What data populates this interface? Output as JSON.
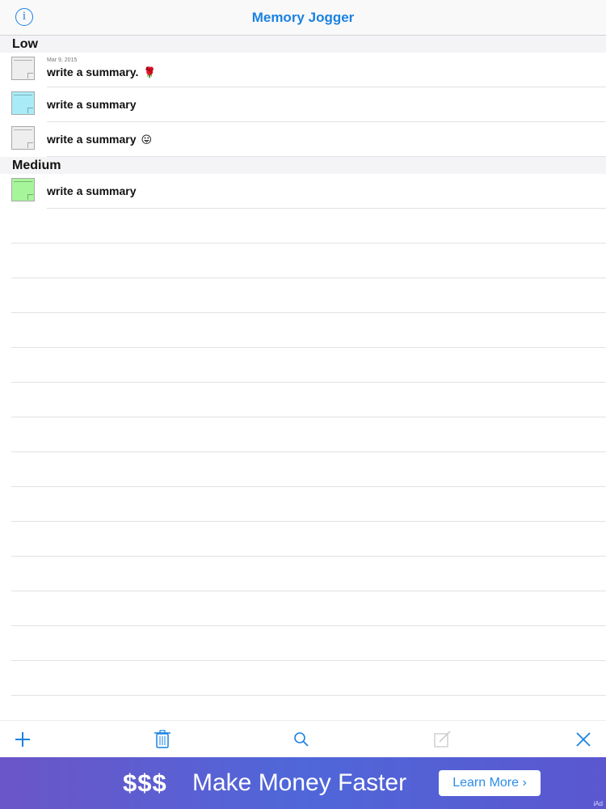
{
  "header": {
    "title": "Memory Jogger",
    "info_label": "i"
  },
  "sections": [
    {
      "title": "Low",
      "items": [
        {
          "date": "Mar 9, 2015",
          "text": "write a summary.",
          "emoji": "🌹",
          "note_color": "#eeeeee"
        },
        {
          "date": "",
          "text": "write a summary",
          "emoji": "",
          "note_color": "#a9ecf8"
        },
        {
          "date": "",
          "text": "write a summary",
          "emoji": "😛",
          "note_color": "#eeeeee"
        }
      ]
    },
    {
      "title": "Medium",
      "items": [
        {
          "date": "",
          "text": "write a summary",
          "emoji": "",
          "note_color": "#a6f59a"
        }
      ]
    }
  ],
  "toolbar": {
    "add_icon": "plus-icon",
    "delete_icon": "trash-icon",
    "search_icon": "search-icon",
    "compose_icon": "compose-icon",
    "close_icon": "close-icon",
    "accent": "#1a82e2"
  },
  "ad": {
    "dollars": "$$$",
    "text": "Make Money Faster",
    "button": "Learn More ›",
    "mark": "iAd"
  }
}
